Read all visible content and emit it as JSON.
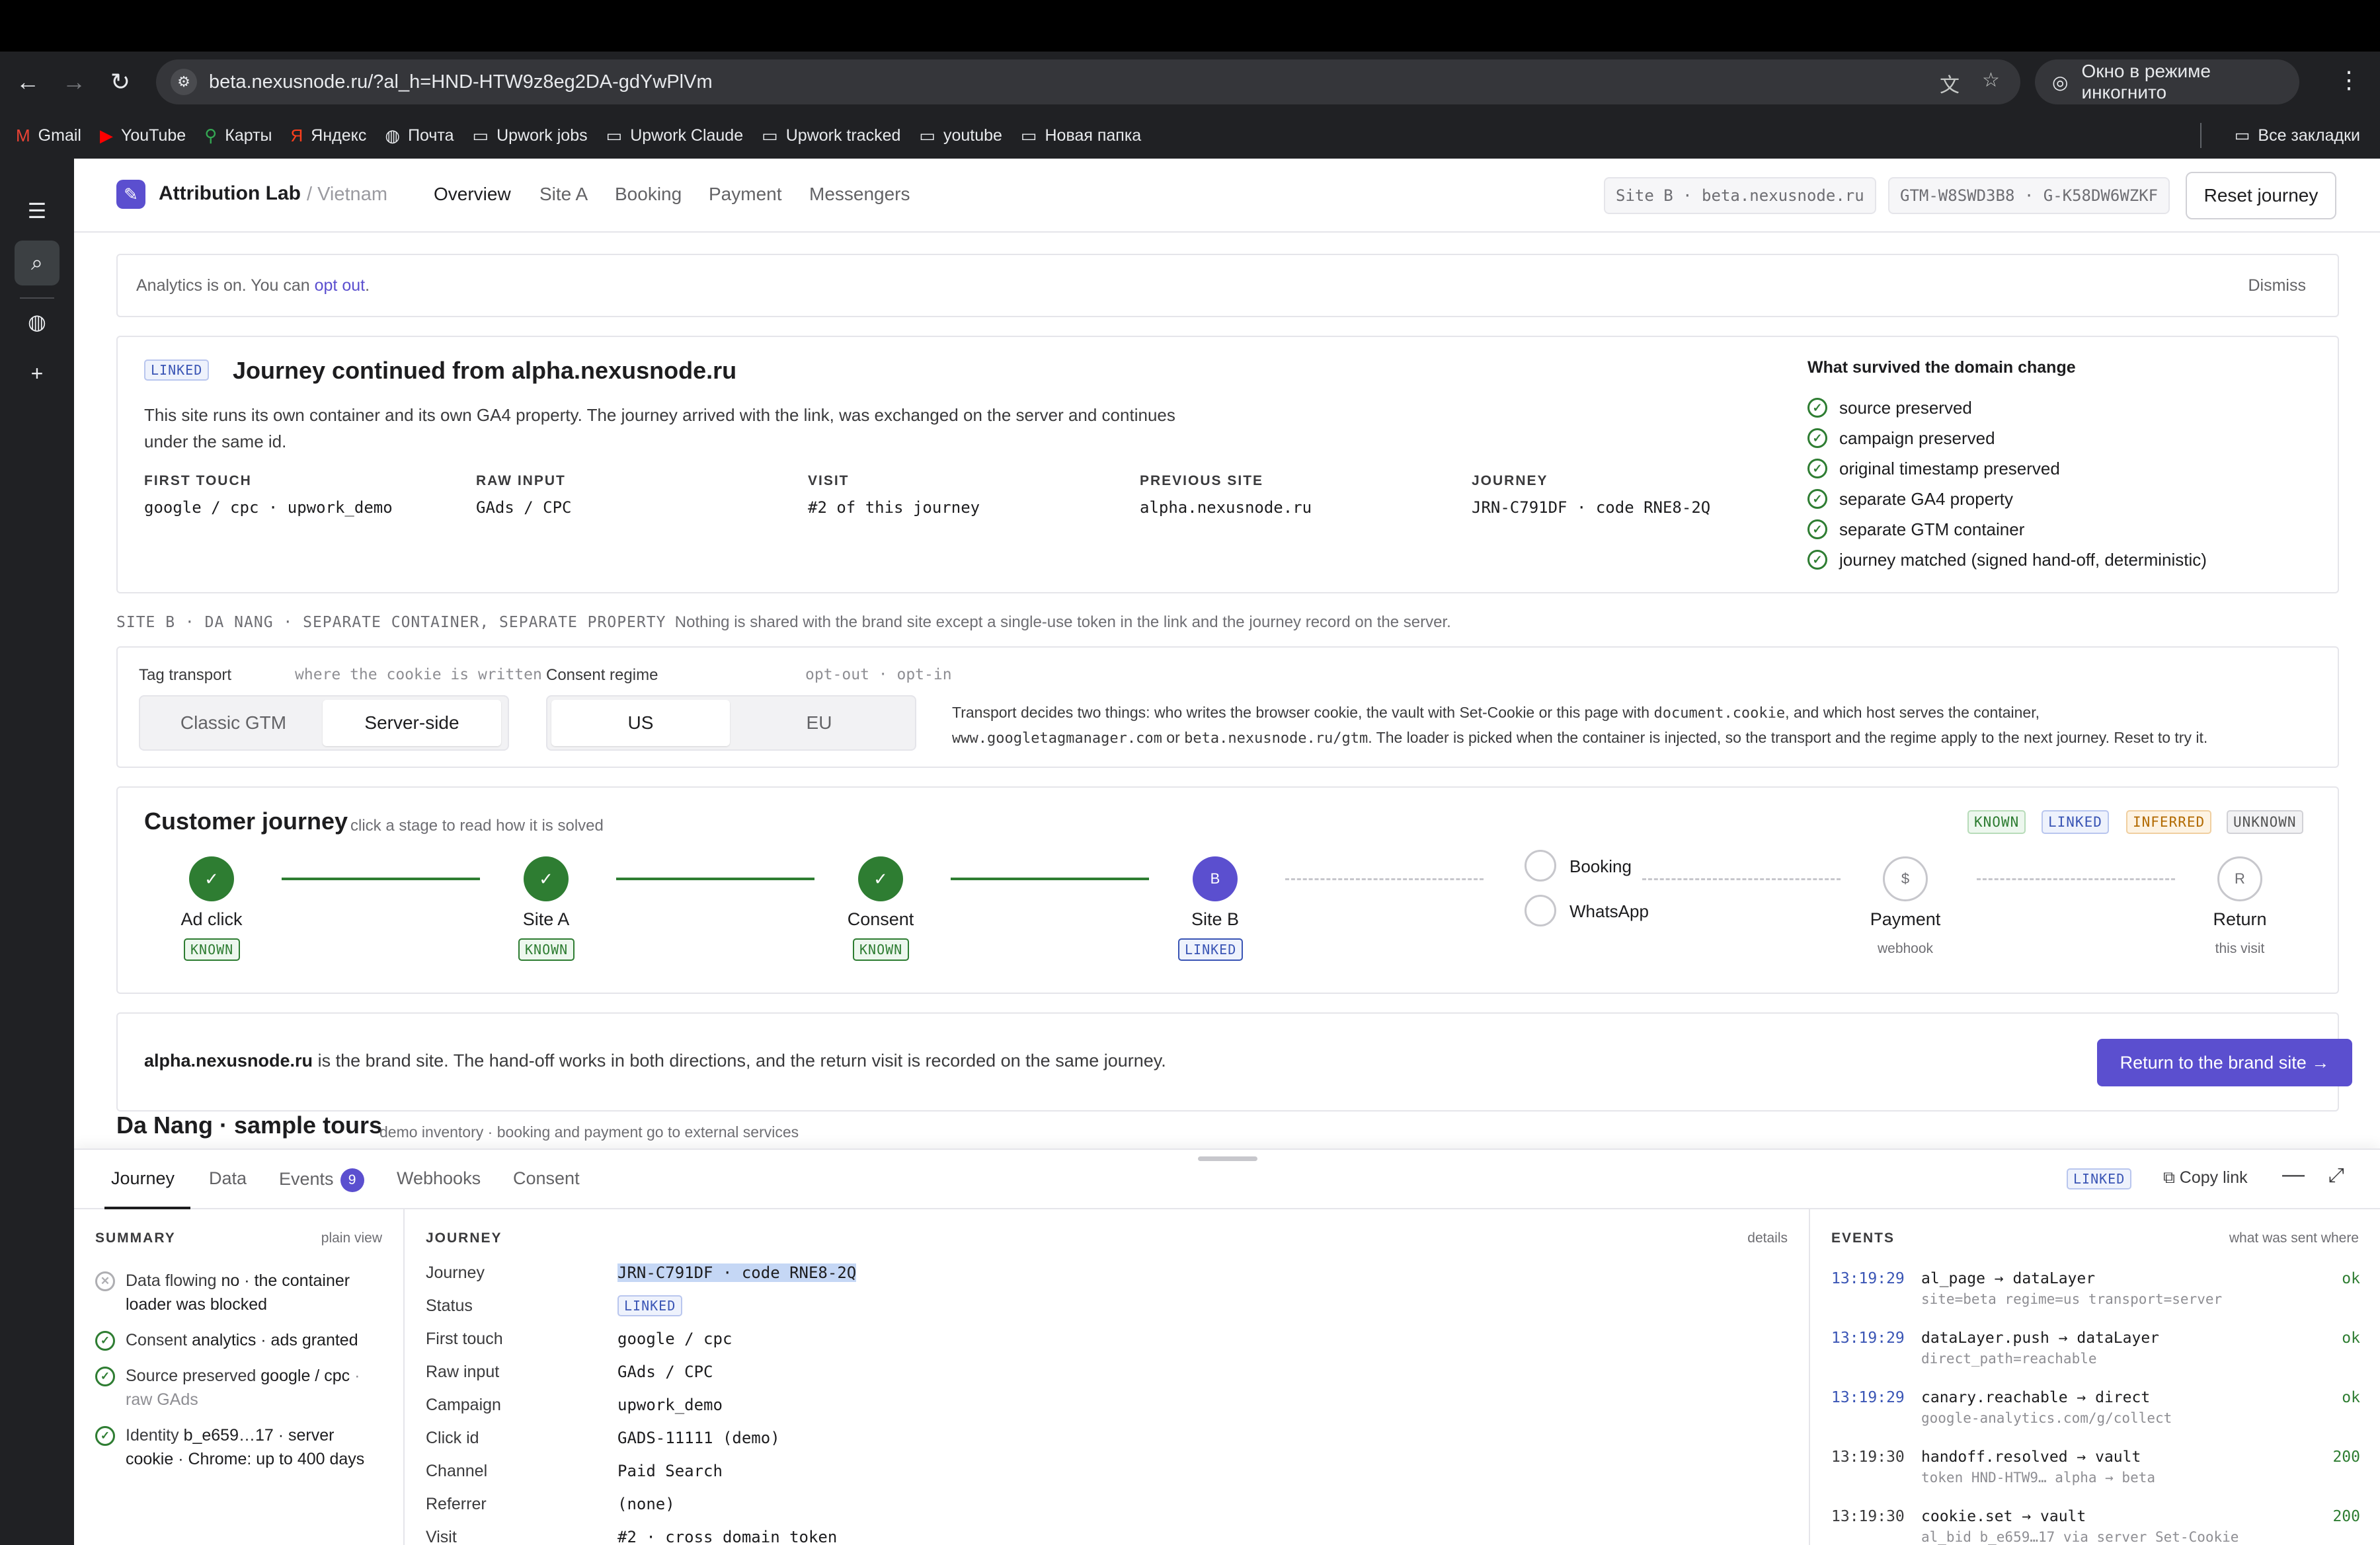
{
  "browser": {
    "url": "beta.nexusnode.ru/?al_h=HND-HTW9z8eg2DA-gdYwPlVm",
    "incognito_label": "Окно в режиме инкогнито",
    "bookmarks": [
      "Gmail",
      "YouTube",
      "Карты",
      "Яндекс",
      "Почта",
      "Upwork jobs",
      "Upwork Claude",
      "Upwork tracked",
      "youtube",
      "Новая папка"
    ],
    "all_bookmarks": "Все закладки"
  },
  "app": {
    "brand": "Attribution Lab",
    "brand_sub": "/ Vietnam",
    "nav": [
      "Overview",
      "Site A",
      "Booking",
      "Payment",
      "Messengers"
    ],
    "site_pill": "Site B · beta.nexusnode.ru",
    "gtm_pill": "GTM-W8SWD3B8 · G-K58DW6WZKF",
    "reset": "Reset journey"
  },
  "notice": {
    "text": "Analytics is on. You can",
    "link": "opt out",
    "end": ".",
    "dismiss": "Dismiss"
  },
  "linked_card": {
    "badge": "LINKED",
    "title": "Journey continued from alpha.nexusnode.ru",
    "desc": "This site runs its own container and its own GA4 property. The journey arrived with the link, was exchanged on the server and continues under the same id.",
    "facts": [
      {
        "k": "FIRST TOUCH",
        "v": "google / cpc · upwork_demo"
      },
      {
        "k": "RAW INPUT",
        "v": "GAds / CPC"
      },
      {
        "k": "VISIT",
        "v": "#2 of this journey"
      },
      {
        "k": "PREVIOUS SITE",
        "v": "alpha.nexusnode.ru"
      },
      {
        "k": "JOURNEY",
        "v": "JRN-C791DF · code RNE8-2Q"
      }
    ],
    "survived_title": "What survived the domain change",
    "survived": [
      "source preserved",
      "campaign preserved",
      "original timestamp preserved",
      "separate GA4 property",
      "separate GTM container",
      "journey matched (signed hand-off, deterministic)"
    ]
  },
  "site_b_line": {
    "label": "SITE B · DA NANG · SEPARATE CONTAINER, SEPARATE PROPERTY",
    "text": "Nothing is shared with the brand site except a single-use token in the link and the journey record on the server."
  },
  "transport": {
    "title": "Tag transport",
    "hint": "where the cookie is written",
    "options": [
      "Classic GTM",
      "Server-side"
    ],
    "selected": "Server-side",
    "consent_title": "Consent regime",
    "consent_hint": "opt-out · opt-in",
    "consent_options": [
      "US",
      "EU"
    ],
    "consent_selected": "US",
    "desc_1": "Transport decides two things: who writes the browser cookie, the vault with Set-Cookie or this page with",
    "desc_code1": "document.cookie",
    "desc_2": ", and which host serves the container,",
    "desc_code2": "www.googletagmanager.com",
    "desc_3": "or",
    "desc_code3": "beta.nexusnode.ru/gtm",
    "desc_4": ". The loader is picked when the container is injected, so the transport and the regime apply to the next journey. Reset to try it."
  },
  "customer_journey": {
    "title": "Customer journey",
    "hint": "click a stage to read how it is solved",
    "legend": [
      "KNOWN",
      "LINKED",
      "INFERRED",
      "UNKNOWN"
    ],
    "stages": [
      {
        "label": "Ad click",
        "badge": "KNOWN",
        "status": "known",
        "node": "✓"
      },
      {
        "label": "Site A",
        "badge": "KNOWN",
        "status": "known",
        "node": "✓"
      },
      {
        "label": "Consent",
        "badge": "KNOWN",
        "status": "known",
        "node": "✓"
      },
      {
        "label": "Site B",
        "badge": "LINKED",
        "status": "linked",
        "node": "B"
      },
      {
        "label": "Payment",
        "sub": "webhook",
        "status": "unknown",
        "node": "$"
      },
      {
        "label": "Return",
        "sub": "this visit",
        "status": "unknown",
        "node": "R"
      }
    ],
    "branch": [
      "Booking",
      "WhatsApp"
    ]
  },
  "brand_box": {
    "site": "alpha.nexusnode.ru",
    "text": "is the brand site. The hand-off works in both directions, and the return visit is recorded on the same journey.",
    "button": "Return to the brand site →"
  },
  "tours": {
    "title": "Da Nang · sample tours",
    "sub": "demo inventory · booking and payment go to external services"
  },
  "drawer": {
    "tabs": [
      "Journey",
      "Data",
      "Events",
      "Webhooks",
      "Consent"
    ],
    "active_tab": "Journey",
    "events_count": "9",
    "badge": "LINKED",
    "copy_link": "Copy link",
    "summary": {
      "title": "SUMMARY",
      "right": "plain view",
      "rows": [
        {
          "ok": false,
          "lead": "Data flowing",
          "value": "no",
          "rest": "· the container loader was blocked",
          "muted": ""
        },
        {
          "ok": true,
          "lead": "Consent",
          "value": "analytics · ads granted",
          "rest": "",
          "muted": ""
        },
        {
          "ok": true,
          "lead": "Source preserved",
          "value": "google / cpc",
          "rest": "·",
          "muted": "raw GAds"
        },
        {
          "ok": true,
          "lead": "Identity",
          "value": "b_e659…17",
          "rest": "· server cookie · Chrome: up to 400 days",
          "muted": ""
        }
      ]
    },
    "journey": {
      "title": "JOURNEY",
      "right": "details",
      "rows": [
        {
          "k": "Journey",
          "v": "JRN-C791DF · code RNE8-2Q"
        },
        {
          "k": "Status",
          "v": "LINKED"
        },
        {
          "k": "First touch",
          "v": "google / cpc"
        },
        {
          "k": "Raw input",
          "v": "GAds / CPC"
        },
        {
          "k": "Campaign",
          "v": "upwork_demo"
        },
        {
          "k": "Click id",
          "v": "GADS-11111 (demo)"
        },
        {
          "k": "Channel",
          "v": "Paid Search"
        },
        {
          "k": "Referrer",
          "v": "(none)"
        },
        {
          "k": "Visit",
          "v": "#2 · cross domain token"
        }
      ]
    },
    "events": {
      "title": "EVENTS",
      "right": "what was sent where",
      "rows": [
        {
          "time": "13:19:29",
          "name": "al_page → dataLayer",
          "det": "site=beta regime=us transport=server",
          "st": "ok"
        },
        {
          "time": "13:19:29",
          "name": "dataLayer.push → dataLayer",
          "det": "direct_path=reachable",
          "st": "ok"
        },
        {
          "time": "13:19:29",
          "name": "canary.reachable → direct",
          "det": "google-analytics.com/g/collect",
          "st": "ok"
        },
        {
          "time": "13:19:30",
          "name": "handoff.resolved → vault",
          "det": "token HND-HTW9… alpha → beta",
          "st": "200"
        },
        {
          "time": "13:19:30",
          "name": "cookie.set → vault",
          "det": "al_bid b_e659…17 via server Set-Cookie",
          "st": "200"
        }
      ]
    }
  }
}
